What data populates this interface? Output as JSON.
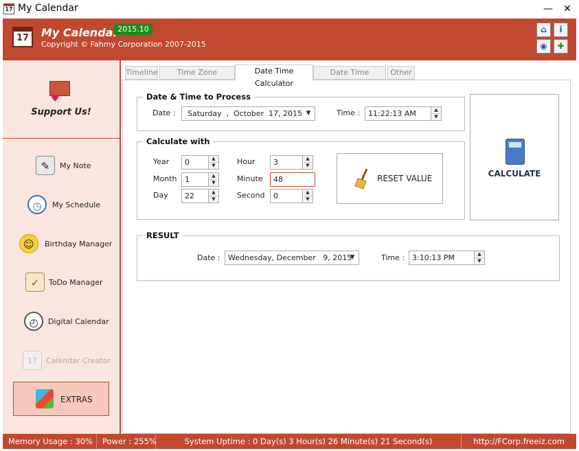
{
  "window": {
    "title": "My Calendar",
    "minimize": "—",
    "maximize": "☐",
    "close": "✕"
  },
  "header": {
    "app_name": "My Calendar",
    "version": "2015.10",
    "copyright": "Copyright © Fahmy Corporation 2007-2015",
    "icons": [
      "home-icon",
      "info-icon",
      "broadcast-icon",
      "plus-icon"
    ]
  },
  "sidebar": {
    "support_label": "Support Us!",
    "items": [
      {
        "label": "My Note",
        "icon": "notepad-icon"
      },
      {
        "label": "My Schedule",
        "icon": "clock-icon"
      },
      {
        "label": "Birthday Manager",
        "icon": "smiley-icon"
      },
      {
        "label": "ToDo Manager",
        "icon": "checklist-icon"
      },
      {
        "label": "Digital Calendar",
        "icon": "calendar-clock-icon"
      },
      {
        "label": "Calendar Creator",
        "icon": "calendar-icon",
        "disabled": true
      }
    ],
    "extras_label": "EXTRAS"
  },
  "tabs": [
    "Timeline",
    "Time Zone Converter",
    "Date Time Calculator",
    "Date Time Comparer",
    "Other"
  ],
  "active_tab": "Date Time Calculator",
  "process": {
    "title": "Date & Time to Process",
    "date_label": "Date :",
    "date_value": "Saturday  ,  October  17, 2015",
    "time_label": "Time :",
    "time_value": "11:22:13 AM"
  },
  "calculate_with": {
    "title": "Calculate with",
    "year_label": "Year",
    "year_value": "0",
    "month_label": "Month",
    "month_value": "1",
    "day_label": "Day",
    "day_value": "22",
    "hour_label": "Hour",
    "hour_value": "3",
    "minute_label": "Minute",
    "minute_value": "48",
    "second_label": "Second",
    "second_value": "0",
    "reset_label": "RESET VALUE"
  },
  "calculate_label": "CALCULATE",
  "result": {
    "title": "RESULT",
    "date_label": "Date :",
    "date_value": "Wednesday, December   9, 2015",
    "time_label": "Time :",
    "time_value": "3:10:13 PM"
  },
  "status": {
    "memory": "Memory Usage : 30%",
    "power": "Power : 255%",
    "uptime": "System Uptime : 0 Day(s) 3 Hour(s) 26 Minute(s) 21 Second(s)",
    "url": "http://FCorp.freeiz.com"
  },
  "colors": {
    "brand": "#c0492f",
    "version_badge": "#1d8b1d",
    "sidebar_bg": "#fbe5e0"
  }
}
